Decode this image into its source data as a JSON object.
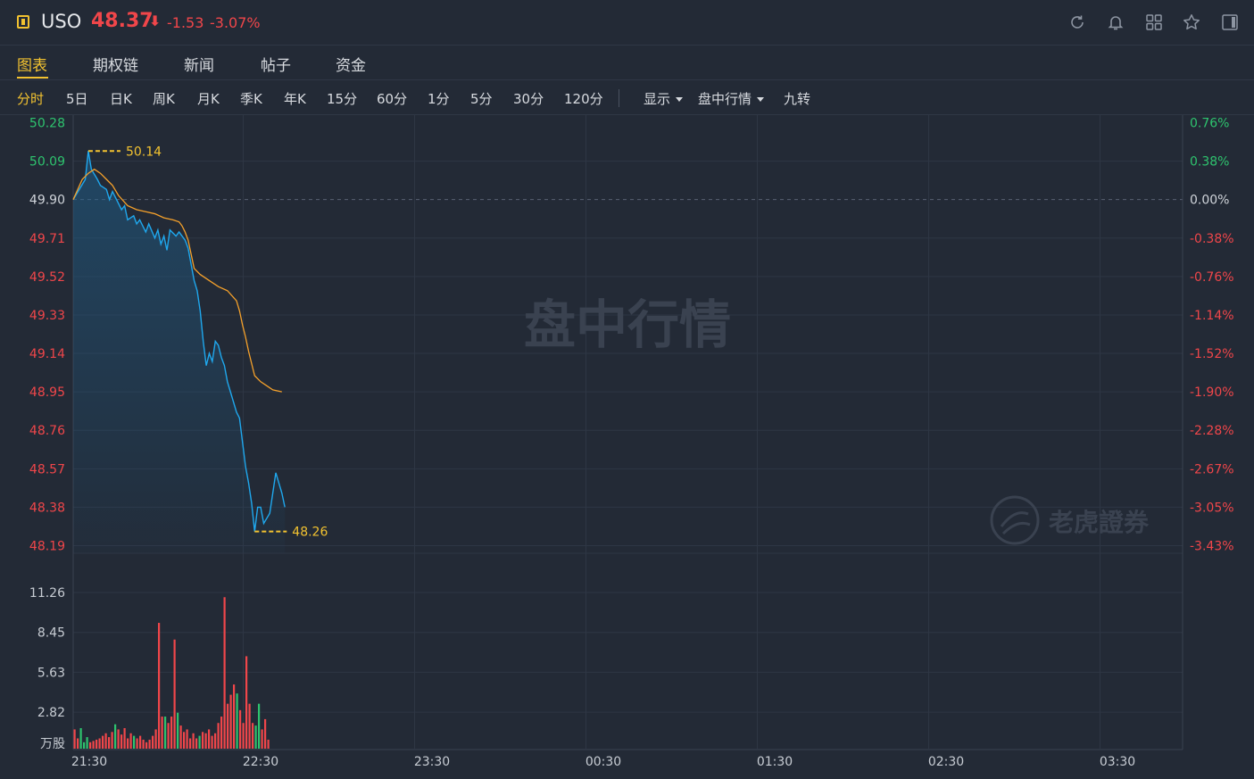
{
  "header": {
    "ticker": "USO",
    "price": "48.37",
    "arrow": "⬇",
    "change": "-1.53",
    "change_pct": "-3.07%",
    "icons": [
      "refresh-icon",
      "bell-icon",
      "grid-icon",
      "star-icon",
      "sidebar-toggle-icon"
    ]
  },
  "tabs": [
    {
      "label": "图表",
      "active": true
    },
    {
      "label": "期权链"
    },
    {
      "label": "新闻"
    },
    {
      "label": "帖子"
    },
    {
      "label": "资金"
    }
  ],
  "periods": [
    "分时",
    "5日",
    "日K",
    "周K",
    "月K",
    "季K",
    "年K",
    "15分",
    "60分",
    "1分",
    "5分",
    "30分",
    "120分"
  ],
  "active_period": "分时",
  "dropdowns": [
    {
      "label": "显示"
    },
    {
      "label": "盘中行情"
    }
  ],
  "extra_button": "九转",
  "watermarks": {
    "center": "盘中行情",
    "brand": "老虎證券"
  },
  "colors": {
    "up": "#f0464a",
    "down": "#2ec36e",
    "price_line": "#1fa8ee",
    "avg_line": "#f5a12b",
    "accent": "#f2c230",
    "background": "#232a36"
  },
  "chart_data": {
    "type": "line",
    "x_tick_labels": [
      "21:30",
      "22:30",
      "23:30",
      "00:30",
      "01:30",
      "02:30",
      "03:30"
    ],
    "y_left_labels": [
      "50.28",
      "50.09",
      "49.90",
      "49.71",
      "49.52",
      "49.33",
      "49.14",
      "48.95",
      "48.76",
      "48.57",
      "48.38",
      "48.19"
    ],
    "y_right_labels": [
      "0.76%",
      "0.38%",
      "0.00%",
      "-0.38%",
      "-0.76%",
      "-1.14%",
      "-1.52%",
      "-1.90%",
      "-2.28%",
      "-2.67%",
      "-3.05%",
      "-3.43%"
    ],
    "ylim": [
      48.19,
      50.28
    ],
    "prev_close": 49.9,
    "x_start_minutes": 0,
    "x_end_minutes": 390,
    "high_label": "50.14",
    "low_label": "48.26",
    "series": [
      {
        "role": "price",
        "points": [
          [
            0,
            49.9
          ],
          [
            2,
            49.95
          ],
          [
            4,
            50.0
          ],
          [
            5,
            50.14
          ],
          [
            6,
            50.05
          ],
          [
            8,
            50.0
          ],
          [
            9,
            49.97
          ],
          [
            11,
            49.95
          ],
          [
            12,
            49.9
          ],
          [
            13,
            49.94
          ],
          [
            15,
            49.88
          ],
          [
            16,
            49.85
          ],
          [
            17,
            49.87
          ],
          [
            18,
            49.8
          ],
          [
            20,
            49.82
          ],
          [
            21,
            49.78
          ],
          [
            22,
            49.8
          ],
          [
            24,
            49.74
          ],
          [
            25,
            49.78
          ],
          [
            27,
            49.71
          ],
          [
            28,
            49.75
          ],
          [
            29,
            49.68
          ],
          [
            30,
            49.72
          ],
          [
            31,
            49.65
          ],
          [
            32,
            49.75
          ],
          [
            34,
            49.72
          ],
          [
            35,
            49.74
          ],
          [
            37,
            49.7
          ],
          [
            38,
            49.66
          ],
          [
            39,
            49.58
          ],
          [
            40,
            49.5
          ],
          [
            41,
            49.45
          ],
          [
            42,
            49.35
          ],
          [
            43,
            49.2
          ],
          [
            44,
            49.08
          ],
          [
            45,
            49.14
          ],
          [
            46,
            49.1
          ],
          [
            47,
            49.2
          ],
          [
            48,
            49.18
          ],
          [
            49,
            49.12
          ],
          [
            50,
            49.08
          ],
          [
            51,
            49.0
          ],
          [
            52,
            48.95
          ],
          [
            53,
            48.9
          ],
          [
            54,
            48.85
          ],
          [
            55,
            48.82
          ],
          [
            56,
            48.7
          ],
          [
            57,
            48.58
          ],
          [
            58,
            48.5
          ],
          [
            59,
            48.4
          ],
          [
            60,
            48.26
          ],
          [
            61,
            48.38
          ],
          [
            62,
            48.38
          ],
          [
            63,
            48.3
          ],
          [
            65,
            48.35
          ],
          [
            67,
            48.55
          ],
          [
            69,
            48.45
          ],
          [
            70,
            48.38
          ]
        ]
      },
      {
        "role": "avg",
        "points": [
          [
            0,
            49.9
          ],
          [
            3,
            50.0
          ],
          [
            5,
            50.03
          ],
          [
            7,
            50.05
          ],
          [
            9,
            50.03
          ],
          [
            11,
            50.0
          ],
          [
            13,
            49.97
          ],
          [
            15,
            49.92
          ],
          [
            18,
            49.87
          ],
          [
            21,
            49.85
          ],
          [
            24,
            49.84
          ],
          [
            27,
            49.83
          ],
          [
            30,
            49.81
          ],
          [
            33,
            49.8
          ],
          [
            35,
            49.79
          ],
          [
            36,
            49.77
          ],
          [
            37,
            49.74
          ],
          [
            38,
            49.7
          ],
          [
            39,
            49.63
          ],
          [
            40,
            49.56
          ],
          [
            42,
            49.53
          ],
          [
            45,
            49.5
          ],
          [
            48,
            49.47
          ],
          [
            51,
            49.45
          ],
          [
            54,
            49.4
          ],
          [
            55,
            49.35
          ],
          [
            56,
            49.28
          ],
          [
            57,
            49.22
          ],
          [
            58,
            49.15
          ],
          [
            59,
            49.09
          ],
          [
            60,
            49.03
          ],
          [
            62,
            49.0
          ],
          [
            64,
            48.98
          ],
          [
            66,
            48.96
          ],
          [
            69,
            48.95
          ]
        ]
      }
    ],
    "volume": {
      "y_labels": [
        "11.26",
        "8.45",
        "5.63",
        "2.82"
      ],
      "unit_label": "万股",
      "ylim": [
        0,
        13
      ],
      "bars": [
        [
          1,
          1.5,
          "u"
        ],
        [
          2,
          0.8,
          "u"
        ],
        [
          3,
          1.6,
          "d"
        ],
        [
          4,
          0.5,
          "d"
        ],
        [
          5,
          0.9,
          "d"
        ],
        [
          6,
          0.5,
          "u"
        ],
        [
          7,
          0.6,
          "u"
        ],
        [
          8,
          0.7,
          "u"
        ],
        [
          9,
          0.8,
          "u"
        ],
        [
          10,
          1.0,
          "u"
        ],
        [
          11,
          1.2,
          "u"
        ],
        [
          12,
          0.9,
          "u"
        ],
        [
          13,
          1.3,
          "u"
        ],
        [
          14,
          1.9,
          "d"
        ],
        [
          15,
          1.5,
          "u"
        ],
        [
          16,
          1.1,
          "u"
        ],
        [
          17,
          1.6,
          "u"
        ],
        [
          18,
          0.8,
          "u"
        ],
        [
          19,
          1.2,
          "u"
        ],
        [
          20,
          1.0,
          "d"
        ],
        [
          21,
          0.8,
          "u"
        ],
        [
          22,
          1.0,
          "u"
        ],
        [
          23,
          0.7,
          "u"
        ],
        [
          24,
          0.5,
          "u"
        ],
        [
          25,
          0.7,
          "u"
        ],
        [
          26,
          1.0,
          "u"
        ],
        [
          27,
          1.5,
          "u"
        ],
        [
          28,
          9.8,
          "u"
        ],
        [
          29,
          2.5,
          "u"
        ],
        [
          30,
          2.5,
          "d"
        ],
        [
          31,
          2.0,
          "u"
        ],
        [
          32,
          2.5,
          "u"
        ],
        [
          33,
          8.5,
          "u"
        ],
        [
          34,
          2.8,
          "d"
        ],
        [
          35,
          1.8,
          "u"
        ],
        [
          36,
          1.3,
          "u"
        ],
        [
          37,
          1.5,
          "u"
        ],
        [
          38,
          0.8,
          "u"
        ],
        [
          39,
          1.2,
          "u"
        ],
        [
          40,
          0.8,
          "u"
        ],
        [
          41,
          1.0,
          "d"
        ],
        [
          42,
          1.3,
          "u"
        ],
        [
          43,
          1.2,
          "u"
        ],
        [
          44,
          1.5,
          "u"
        ],
        [
          45,
          1.0,
          "u"
        ],
        [
          46,
          1.2,
          "u"
        ],
        [
          47,
          2.0,
          "u"
        ],
        [
          48,
          2.5,
          "u"
        ],
        [
          49,
          11.8,
          "u"
        ],
        [
          50,
          3.5,
          "u"
        ],
        [
          51,
          4.2,
          "u"
        ],
        [
          52,
          5.0,
          "u"
        ],
        [
          53,
          4.3,
          "d"
        ],
        [
          54,
          3.0,
          "u"
        ],
        [
          55,
          2.0,
          "u"
        ],
        [
          56,
          7.2,
          "u"
        ],
        [
          57,
          3.5,
          "u"
        ],
        [
          58,
          2.0,
          "u"
        ],
        [
          59,
          1.8,
          "d"
        ],
        [
          60,
          3.5,
          "d"
        ],
        [
          61,
          1.5,
          "u"
        ],
        [
          62,
          2.3,
          "u"
        ],
        [
          63,
          0.7,
          "u"
        ]
      ]
    }
  }
}
